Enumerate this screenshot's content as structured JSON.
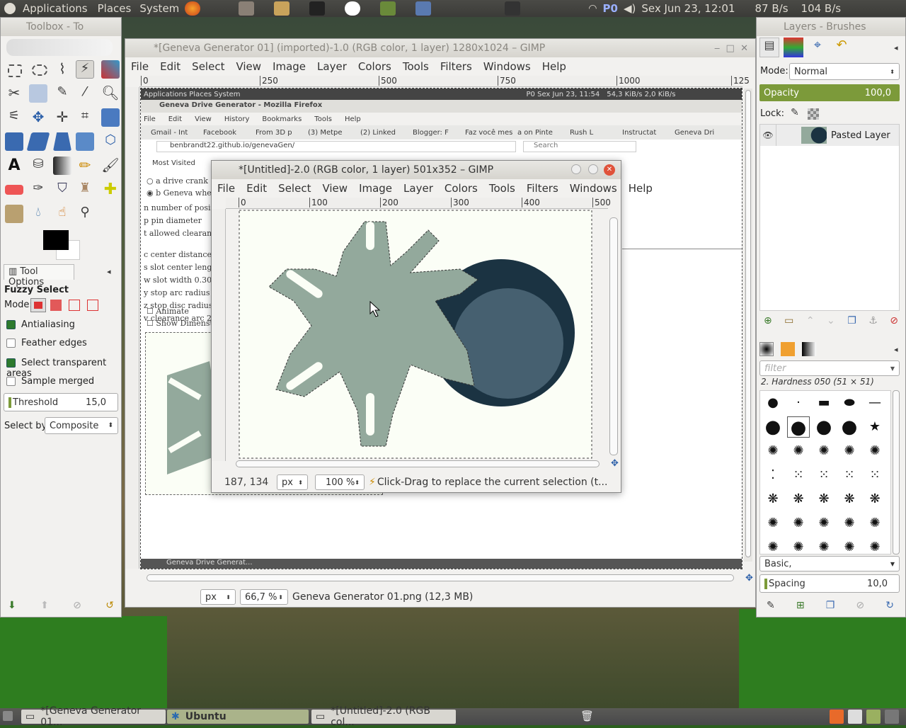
{
  "top_panel": {
    "applications": "Applications",
    "places": "Places",
    "system": "System",
    "network": "P0",
    "datetime": "Sex Jun 23, 12:01",
    "down": "87 B/s",
    "up": "104 B/s"
  },
  "toolbox": {
    "title": "Toolbox - To",
    "tool_options_tab": "Tool Options",
    "tool_name": "Fuzzy Select",
    "mode_label": "Mode:",
    "antialiasing": "Antialiasing",
    "feather": "Feather edges",
    "select_transparent": "Select transparent areas",
    "sample_merged": "Sample merged",
    "threshold_label": "Threshold",
    "threshold_value": "15,0",
    "select_by_label": "Select by:",
    "select_by_value": "Composite"
  },
  "main_window": {
    "title": "*[Geneva Generator 01] (imported)-1.0 (RGB color, 1 layer) 1280x1024 – GIMP",
    "menu": [
      "File",
      "Edit",
      "Select",
      "View",
      "Image",
      "Layer",
      "Colors",
      "Tools",
      "Filters",
      "Windows",
      "Help"
    ],
    "ruler": [
      "0",
      "250",
      "500",
      "750",
      "1000",
      "125"
    ],
    "unit": "px",
    "zoom": "66,7 %",
    "status": "Geneva Generator 01.png (12,3 MB)"
  },
  "inner_ff": {
    "panel_left": "Applications   Places   System",
    "panel_right": "P0   Sex Jun 23, 11:54",
    "speed": "54,3 KiB/s   2,0 KiB/s",
    "title": "Geneva Drive Generator - Mozilla Firefox",
    "menu": [
      "File",
      "Edit",
      "View",
      "History",
      "Bookmarks",
      "Tools",
      "Help"
    ],
    "tabs": [
      "Gmail - Int",
      "Facebook",
      "From 3D p",
      "(3) Metpe",
      "(2) Linked",
      "Blogger: F",
      "Faz você mes",
      "a on Pinte",
      "Rush L",
      "Instructat",
      "Geneva Dri"
    ],
    "url": "benbrandt22.github.io/genevaGen/",
    "search": "Search",
    "most_visited": "Most Visited",
    "radio_a": "a drive crank",
    "radio_b": "b Geneva whe",
    "lines": [
      "n number of posit",
      "p pin diameter",
      "t allowed clearanc",
      "c center distance",
      "s slot center lengt",
      "w slot width 0.300",
      "y stop arc radius",
      "z stop disc radius",
      "v clearance arc 2."
    ],
    "animate": "Animate",
    "show_dim": "Show Dimenst",
    "task": "Geneva Drive Generat..."
  },
  "untitled": {
    "title": "*[Untitled]-2.0 (RGB color, 1 layer) 501x352 – GIMP",
    "menu": [
      "File",
      "Edit",
      "Select",
      "View",
      "Image",
      "Layer",
      "Colors",
      "Tools",
      "Filters",
      "Windows",
      "Help"
    ],
    "ruler": [
      "0",
      "100",
      "200",
      "300",
      "400",
      "500"
    ],
    "coords": "187, 134",
    "unit": "px",
    "zoom": "100 %",
    "status": "Click-Drag to replace the current selection (t..."
  },
  "layers": {
    "title": "Layers - Brushes",
    "mode_label": "Mode:",
    "mode_value": "Normal",
    "opacity_label": "Opacity",
    "opacity_value": "100,0",
    "lock_label": "Lock:",
    "layer_name": "Pasted Layer",
    "filter_placeholder": "filter",
    "brush_name": "2. Hardness 050 (51 × 51)",
    "preset": "Basic,",
    "spacing_label": "Spacing",
    "spacing_value": "10,0"
  },
  "taskbar": {
    "items": [
      "*[Geneva Generator 01...",
      "Ubuntu",
      "*[Untitled]-2.0 (RGB col..."
    ]
  },
  "colors": {
    "gear": "#93a99c",
    "disc": "#1b3342",
    "disc_inner": "#466070",
    "canvas": "#fbfef6",
    "opacity_bar": "#7c9a3a"
  }
}
